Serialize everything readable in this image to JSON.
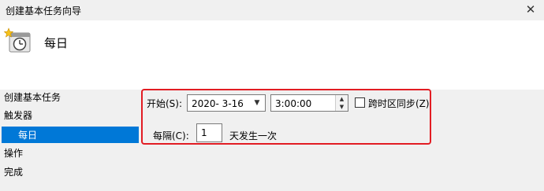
{
  "window": {
    "title": "创建基本任务向导",
    "close_glyph": "✕"
  },
  "header": {
    "title": "每日",
    "icon": "clock-calendar-icon"
  },
  "nav": {
    "items": [
      "创建基本任务",
      "触发器",
      "每日",
      "操作",
      "完成"
    ],
    "selected_index": 2
  },
  "form": {
    "start_label": "开始(S):",
    "start_date": "2020- 3-16",
    "start_time": "3:00:00",
    "sync_timezone_label": "跨时区同步(Z)",
    "sync_timezone_checked": false,
    "recur_label": "每隔(C):",
    "recur_value": "1",
    "recur_suffix": "天发生一次"
  },
  "colors": {
    "highlight": "#e21c23",
    "selection": "#0078d7"
  }
}
